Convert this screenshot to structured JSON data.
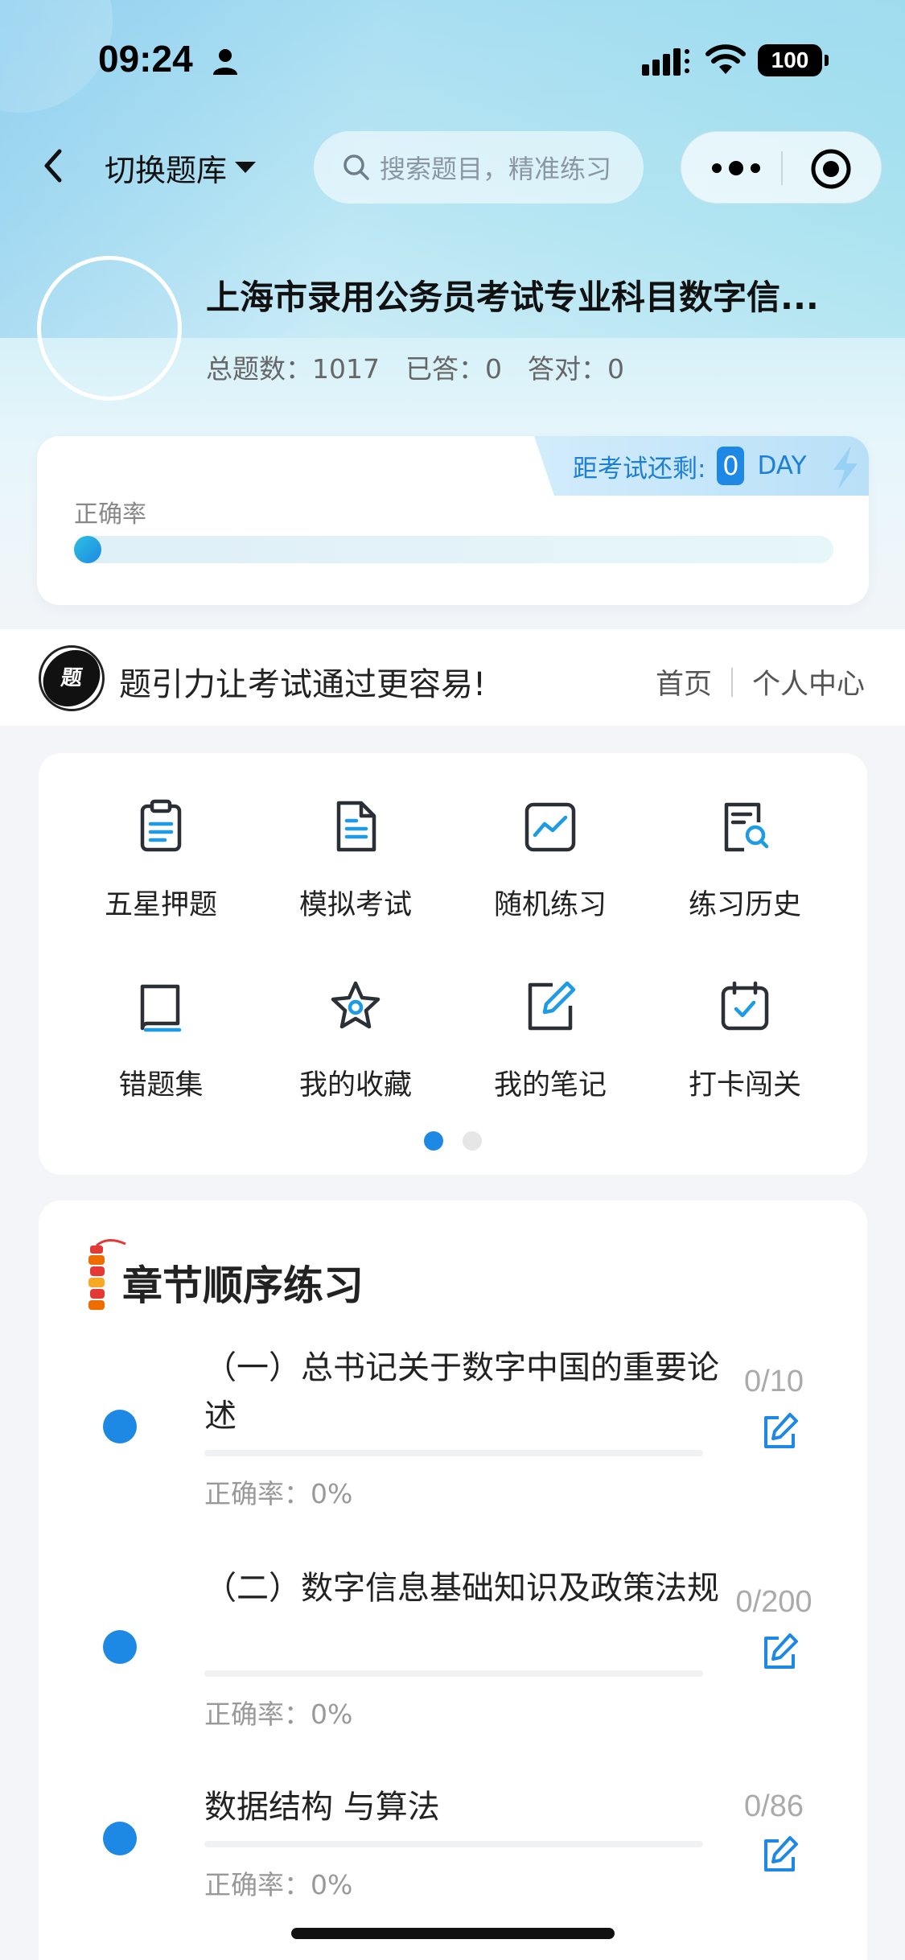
{
  "status_bar": {
    "time": "09:24",
    "battery": "100"
  },
  "nav": {
    "switch_bank_label": "切换题库",
    "search_placeholder": "搜索题目，精准练习"
  },
  "bank": {
    "title": "上海市录用公务员考试专业科目数字信...",
    "total": "总题数：1017",
    "answered": "已答：0",
    "correct": "答对：0"
  },
  "accuracy": {
    "label": "正确率",
    "value": 0,
    "countdown_label": "距考试还剩:",
    "countdown_days": "0",
    "countdown_unit": "DAY"
  },
  "brand": {
    "slogan": "题引力让考试通过更容易!",
    "home_link": "首页",
    "profile_link": "个人中心"
  },
  "features": [
    {
      "label": "五星押题",
      "icon": "clipboard-icon"
    },
    {
      "label": "模拟考试",
      "icon": "document-icon"
    },
    {
      "label": "随机练习",
      "icon": "chart-icon"
    },
    {
      "label": "练习历史",
      "icon": "history-search-icon"
    },
    {
      "label": "错题集",
      "icon": "book-icon"
    },
    {
      "label": "我的收藏",
      "icon": "star-icon"
    },
    {
      "label": "我的笔记",
      "icon": "note-edit-icon"
    },
    {
      "label": "打卡闯关",
      "icon": "calendar-check-icon"
    }
  ],
  "pagination": {
    "pages": 2,
    "active": 1
  },
  "chapters": {
    "title": "章节顺序练习",
    "items": [
      {
        "name": "（一）总书记关于数字中国的重要论述",
        "accuracy": "正确率：0%",
        "progress": "0/10"
      },
      {
        "name": "（二）数字信息基础知识及政策法规",
        "accuracy": "正确率：0%",
        "progress": "0/200"
      },
      {
        "name": "数据结构 与算法",
        "accuracy": "正确率：0%",
        "progress": "0/86"
      }
    ]
  },
  "colors": {
    "accent": "#1e88e5",
    "accent_light": "#2cc1e0"
  }
}
